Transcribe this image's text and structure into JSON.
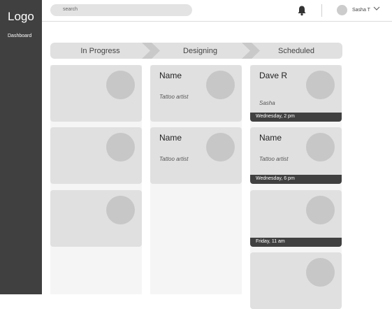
{
  "sidebar": {
    "logo": "Logo",
    "items": [
      {
        "label": "Dashboard"
      }
    ]
  },
  "header": {
    "search_placeholder": "search",
    "user_name": "Sasha T"
  },
  "pipeline": {
    "stages": [
      "In Progress",
      "Designing",
      "Scheduled"
    ],
    "in_progress": [
      {},
      {},
      {}
    ],
    "designing": [
      {
        "name": "Name",
        "role": "Tattoo artist"
      },
      {
        "name": "Name",
        "role": "Tattoo artist"
      }
    ],
    "scheduled": [
      {
        "name": "Dave R",
        "role": "Sasha",
        "time": "Wednesday, 2 pm"
      },
      {
        "name": "Name",
        "role": "Tattoo artist",
        "time": "Wednesday, 6 pm"
      },
      {
        "time": "Friday, 11 am"
      },
      {}
    ]
  },
  "colors": {
    "sidebar": "#404040",
    "card": "#e0e0e0",
    "band": "#404040"
  }
}
